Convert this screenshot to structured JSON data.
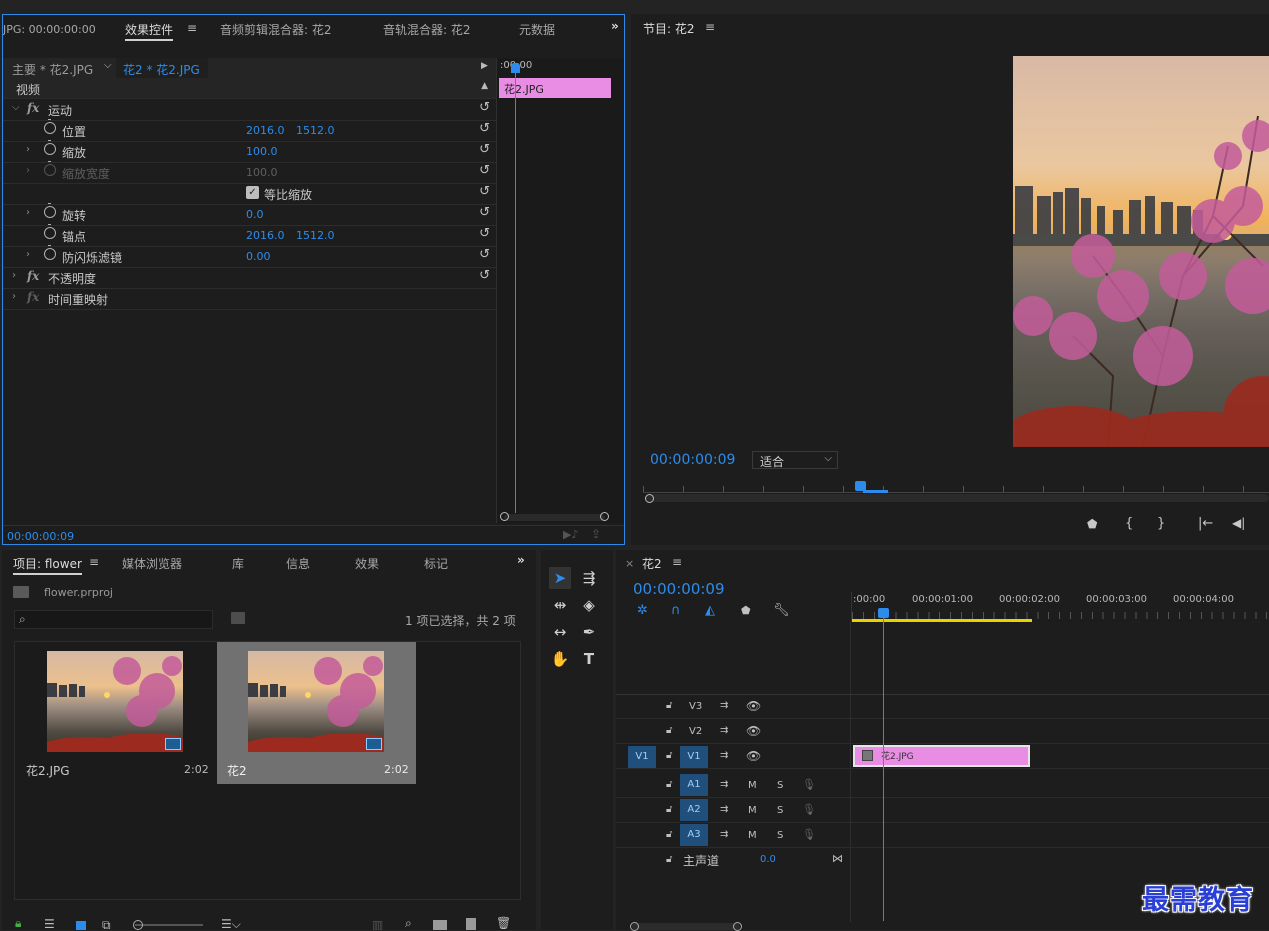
{
  "effect_controls": {
    "left_clip_tc": "JPG: 00:00:00:00",
    "tabs": [
      "效果控件",
      "音频剪辑混合器: 花2",
      "音轨混合器: 花2",
      "元数据"
    ],
    "master_label": "主要 * 花2.JPG",
    "seq_clip_label": "花2 * 花2.JPG",
    "ruler_start": ":00:00",
    "clip_name": "花2.JPG",
    "section_video": "视频",
    "motion": "运动",
    "position": {
      "label": "位置",
      "x": "2016.0",
      "y": "1512.0"
    },
    "scale": {
      "label": "缩放",
      "value": "100.0"
    },
    "scale_width": {
      "label": "缩放宽度",
      "value": "100.0"
    },
    "uniform_scale": "等比缩放",
    "rotation": {
      "label": "旋转",
      "value": "0.0"
    },
    "anchor": {
      "label": "锚点",
      "x": "2016.0",
      "y": "1512.0"
    },
    "antiflicker": {
      "label": "防闪烁滤镜",
      "value": "0.00"
    },
    "opacity": "不透明度",
    "time_remap": "时间重映射",
    "bottom_tc": "00:00:00:09"
  },
  "program_monitor": {
    "title": "节目: 花2",
    "timecode": "00:00:00:09",
    "zoom": "适合"
  },
  "project_panel": {
    "tabs": [
      "项目: flower",
      "媒体浏览器",
      "库",
      "信息",
      "效果",
      "标记"
    ],
    "project_file": "flower.prproj",
    "search_placeholder": "",
    "selection_info": "1 项已选择，共 2 项",
    "items": [
      {
        "name": "花2.JPG",
        "duration": "2:02"
      },
      {
        "name": "花2",
        "duration": "2:02"
      }
    ]
  },
  "timeline": {
    "seq_name": "花2",
    "timecode": "00:00:00:09",
    "ruler": [
      ":00:00",
      "00:00:01:00",
      "00:00:02:00",
      "00:00:03:00",
      "00:00:04:00"
    ],
    "video_tracks": [
      "V3",
      "V2",
      "V1"
    ],
    "audio_tracks": [
      "A1",
      "A2",
      "A3"
    ],
    "source_v": "V1",
    "mute": "M",
    "solo": "S",
    "master": {
      "label": "主声道",
      "value": "0.0"
    },
    "clip_name": "花2.JPG"
  },
  "watermark": "最需教育",
  "colors": {
    "accent": "#2d8ceb",
    "clip": "#e98de4",
    "work_area": "#e8d200"
  }
}
